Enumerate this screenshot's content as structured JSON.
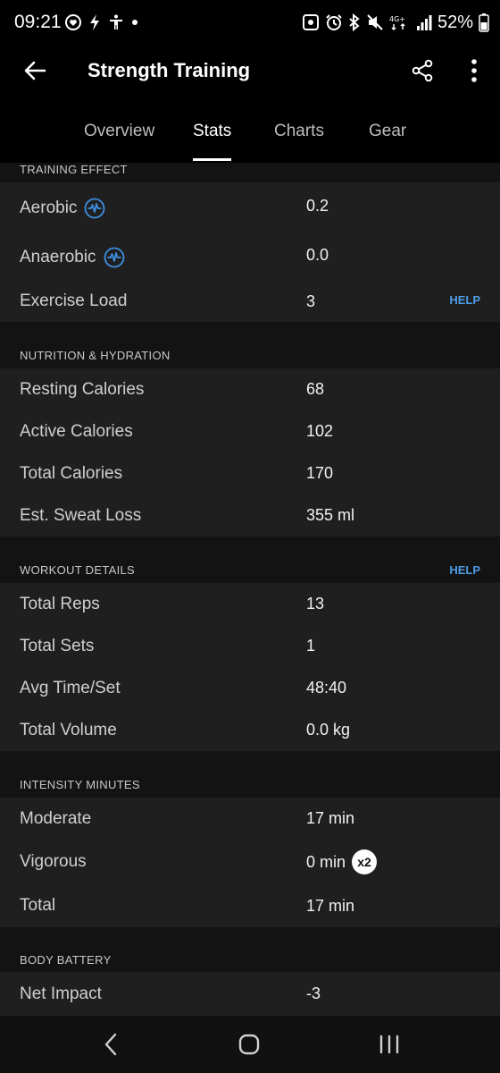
{
  "status_bar": {
    "time": "09:21",
    "battery": "52%",
    "network": "4G+"
  },
  "app_bar": {
    "title": "Strength Training",
    "icons": {
      "back": "back-arrow-icon",
      "share": "share-icon",
      "more": "more-vertical-icon"
    }
  },
  "tabs": [
    {
      "label": "Overview",
      "active": false
    },
    {
      "label": "Stats",
      "active": true
    },
    {
      "label": "Charts",
      "active": false
    },
    {
      "label": "Gear",
      "active": false
    }
  ],
  "sections": {
    "training_effect": {
      "title": "TRAINING EFFECT",
      "rows": [
        {
          "label": "Aerobic",
          "value": "0.2",
          "icon": "training-effect-icon"
        },
        {
          "label": "Anaerobic",
          "value": "0.0",
          "icon": "training-effect-icon"
        },
        {
          "label": "Exercise Load",
          "value": "3",
          "help": "HELP"
        }
      ]
    },
    "nutrition": {
      "title": "NUTRITION & HYDRATION",
      "rows": [
        {
          "label": "Resting Calories",
          "value": "68"
        },
        {
          "label": "Active Calories",
          "value": "102"
        },
        {
          "label": "Total Calories",
          "value": "170"
        },
        {
          "label": "Est. Sweat Loss",
          "value": "355 ml"
        }
      ]
    },
    "workout": {
      "title": "WORKOUT DETAILS",
      "help": "HELP",
      "rows": [
        {
          "label": "Total Reps",
          "value": "13"
        },
        {
          "label": "Total Sets",
          "value": "1"
        },
        {
          "label": "Avg Time/Set",
          "value": "48:40"
        },
        {
          "label": "Total Volume",
          "value": "0.0 kg"
        }
      ]
    },
    "intensity": {
      "title": "INTENSITY MINUTES",
      "rows": [
        {
          "label": "Moderate",
          "value": "17 min"
        },
        {
          "label": "Vigorous",
          "value": "0 min",
          "badge": "x2"
        },
        {
          "label": "Total",
          "value": "17 min"
        }
      ]
    },
    "body_battery": {
      "title": "BODY BATTERY",
      "rows": [
        {
          "label": "Net Impact",
          "value": "-3"
        }
      ]
    }
  },
  "colors": {
    "background": "#000000",
    "section_body": "#1f1f1f",
    "section_header": "#131313",
    "accent_link": "#4d9be6",
    "icon_blue": "#3d8fe0"
  }
}
